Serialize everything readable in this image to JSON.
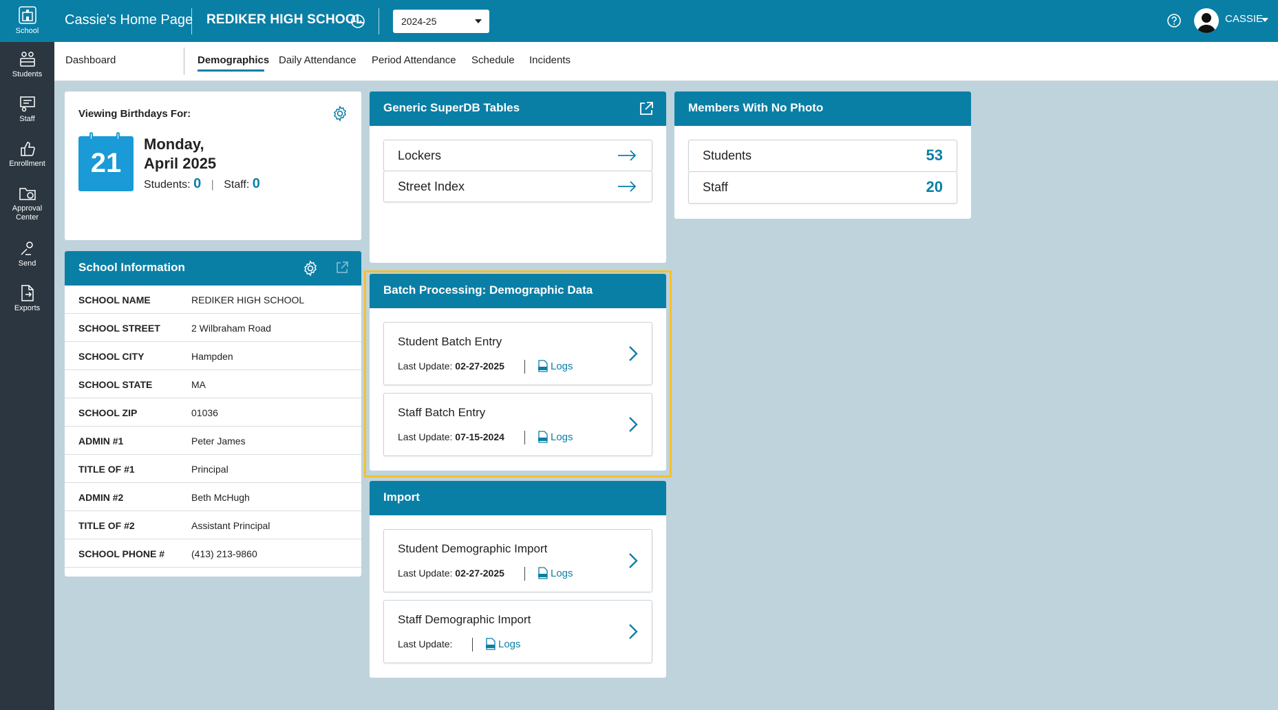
{
  "leftnav": {
    "items": [
      {
        "label": "School"
      },
      {
        "label": "Students"
      },
      {
        "label": "Staff"
      },
      {
        "label": "Enrollment"
      },
      {
        "label": "Approval Center"
      },
      {
        "label": "Send"
      },
      {
        "label": "Exports"
      }
    ]
  },
  "topbar": {
    "home_title": "Cassie's Home Page",
    "school_name": "REDIKER HIGH SCHOOL",
    "school_year": "2024-25",
    "user_name": "CASSIE"
  },
  "tabs": [
    "Dashboard",
    "Demographics",
    "Daily Attendance",
    "Period Attendance",
    "Schedule",
    "Incidents"
  ],
  "active_tab": "Demographics",
  "birthdays": {
    "label": "Viewing Birthdays For:",
    "day": "21",
    "date_line1": "Monday,",
    "date_line2": "April 2025",
    "students_label": "Students:",
    "students_count": "0",
    "separator": "|",
    "staff_label": "Staff:",
    "staff_count": "0"
  },
  "school_info": {
    "title": "School Information",
    "rows": [
      {
        "key": "SCHOOL NAME",
        "value": "REDIKER HIGH SCHOOL"
      },
      {
        "key": "SCHOOL STREET",
        "value": "2 Wilbraham Road"
      },
      {
        "key": "SCHOOL CITY",
        "value": "Hampden"
      },
      {
        "key": "SCHOOL STATE",
        "value": "MA"
      },
      {
        "key": "SCHOOL ZIP",
        "value": "01036"
      },
      {
        "key": "ADMIN #1",
        "value": "Peter James"
      },
      {
        "key": "TITLE OF #1",
        "value": "Principal"
      },
      {
        "key": "ADMIN #2",
        "value": "Beth McHugh"
      },
      {
        "key": "TITLE OF #2",
        "value": "Assistant Principal"
      },
      {
        "key": "SCHOOL PHONE #",
        "value": "(413) 213-9860"
      }
    ]
  },
  "superdb": {
    "title": "Generic SuperDB Tables",
    "items": [
      {
        "label": "Lockers"
      },
      {
        "label": "Street Index"
      }
    ]
  },
  "no_photo": {
    "title": "Members With No Photo",
    "items": [
      {
        "label": "Students",
        "count": "53"
      },
      {
        "label": "Staff",
        "count": "20"
      }
    ]
  },
  "batch": {
    "title": "Batch Processing: Demographic Data",
    "items": [
      {
        "title": "Student Batch Entry",
        "update_label": "Last Update:",
        "date": "02-27-2025",
        "logs": "Logs"
      },
      {
        "title": "Staff Batch Entry",
        "update_label": "Last Update:",
        "date": "07-15-2024",
        "logs": "Logs"
      }
    ]
  },
  "import": {
    "title": "Import",
    "items": [
      {
        "title": "Student Demographic Import",
        "update_label": "Last Update:",
        "date": "02-27-2025",
        "logs": "Logs"
      },
      {
        "title": "Staff Demographic Import",
        "update_label": "Last Update:",
        "date": "",
        "logs": "Logs"
      }
    ]
  },
  "colors": {
    "primary": "#0a7fa6",
    "sidebar": "#2b3640",
    "background": "#bfd3dc",
    "highlight": "#f5c128",
    "calendar": "#1a9ad7"
  }
}
